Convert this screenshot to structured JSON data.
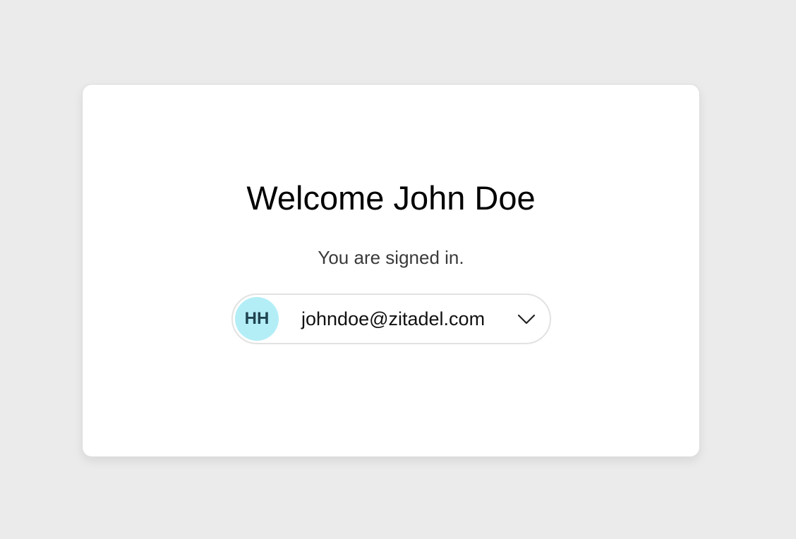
{
  "welcome": {
    "title": "Welcome John Doe",
    "subtitle": "You are signed in."
  },
  "account": {
    "initials": "HH",
    "email": "johndoe@zitadel.com",
    "avatar_color": "#b3eef7",
    "dropdown_icon": "chevron-down-icon"
  }
}
